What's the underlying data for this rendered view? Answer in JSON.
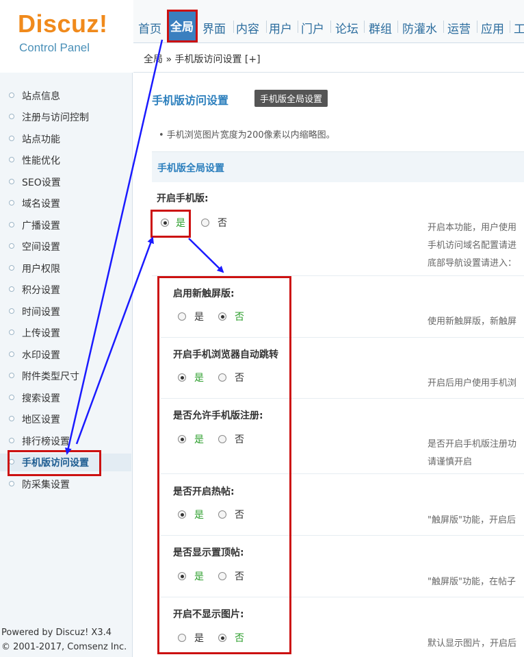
{
  "logo": {
    "brand": "Discuz!",
    "subtitle": "Control Panel"
  },
  "topnav": {
    "items": [
      "首页",
      "全局",
      "界面",
      "内容",
      "用户",
      "门户",
      "论坛",
      "群组",
      "防灌水",
      "运营",
      "应用",
      "工"
    ],
    "active": "全局"
  },
  "breadcrumb": "全局 » 手机版访问设置 [+]",
  "sidebar": {
    "items": [
      "站点信息",
      "注册与访问控制",
      "站点功能",
      "性能优化",
      "SEO设置",
      "域名设置",
      "广播设置",
      "空间设置",
      "用户权限",
      "积分设置",
      "时间设置",
      "上传设置",
      "水印设置",
      "附件类型尺寸",
      "搜索设置",
      "地区设置",
      "排行榜设置",
      "手机版访问设置",
      "防采集设置"
    ],
    "active": "手机版访问设置"
  },
  "footer": {
    "line1": "Powered by Discuz! X3.4",
    "line2": "© 2001-2017, Comsenz Inc."
  },
  "main": {
    "title": "手机版访问设置",
    "title_button": "手机版全局设置",
    "tip": "• 手机浏览图片宽度为200像素以内缩略图。",
    "section_title": "手机版全局设置",
    "yes": "是",
    "no": "否",
    "settings": [
      {
        "label": "开启手机版:",
        "value": "是",
        "desc": [
          "开启本功能，用户使用",
          "手机访问域名配置请进",
          "底部导航设置请进入："
        ]
      },
      {
        "label": "启用新触屏版:",
        "value": "否",
        "desc": [
          "使用新触屏版，新触屏"
        ]
      },
      {
        "label": "开启手机浏览器自动跳转",
        "value": "是",
        "desc": [
          "开启后用户使用手机浏"
        ]
      },
      {
        "label": "是否允许手机版注册:",
        "value": "是",
        "desc": [
          "是否开启手机版注册功",
          "请谨慎开启"
        ]
      },
      {
        "label": "是否开启热帖:",
        "value": "是",
        "desc": [
          "\"触屏版\"功能，开启后"
        ]
      },
      {
        "label": "是否显示置顶帖:",
        "value": "是",
        "desc": [
          "\"触屏版\"功能，在帖子"
        ]
      },
      {
        "label": "开启不显示图片:",
        "value": "否",
        "desc": [
          "默认显示图片，开启后"
        ]
      }
    ]
  },
  "colors": {
    "annotation": "#cc1111",
    "arrow": "#1a1aff",
    "accent": "#2c7fbd",
    "checked_text": "#2a9d2a"
  }
}
